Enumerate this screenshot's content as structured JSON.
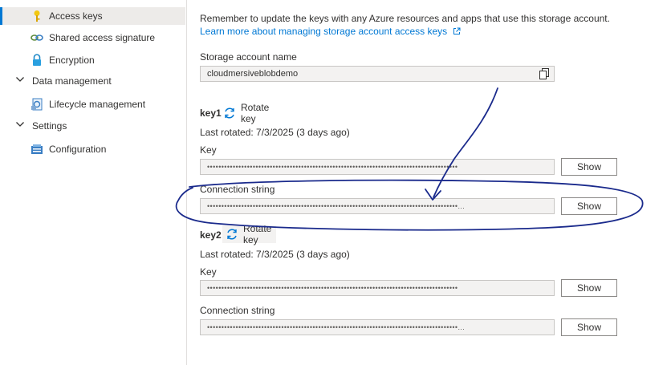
{
  "sidebar": {
    "items": [
      {
        "label": "Access keys",
        "icon": "key-icon"
      },
      {
        "label": "Shared access signature",
        "icon": "link-icon"
      },
      {
        "label": "Encryption",
        "icon": "lock-icon"
      },
      {
        "label": "Data management",
        "icon": "chevron-down-icon"
      },
      {
        "label": "Lifecycle management",
        "icon": "lifecycle-icon"
      },
      {
        "label": "Settings",
        "icon": "chevron-down-icon"
      },
      {
        "label": "Configuration",
        "icon": "configuration-icon"
      }
    ]
  },
  "main": {
    "reminder": "Remember to update the keys with any Azure resources and apps that use this storage account.",
    "learn_more": "Learn more about managing storage account access keys",
    "storage_account_label": "Storage account name",
    "storage_account_value": "cloudmersiveblobdemo",
    "key1": {
      "title": "key1",
      "rotate_label": "Rotate key",
      "last_rotated": "Last rotated: 7/3/2025 (3 days ago)",
      "key_label": "Key",
      "key_value": "••••••••••••••••••••••••••••••••••••••••••••••••••••••••••••••••••••••••••••••••••••••••",
      "conn_label": "Connection string",
      "conn_value": "••••••••••••••••••••••••••••••••••••••••••••••••••••••••••••••••••••••••••••••••••••••••...",
      "show_label": "Show"
    },
    "key2": {
      "title": "key2",
      "rotate_label": "Rotate key",
      "last_rotated": "Last rotated: 7/3/2025 (3 days ago)",
      "key_label": "Key",
      "key_value": "••••••••••••••••••••••••••••••••••••••••••••••••••••••••••••••••••••••••••••••••••••••••",
      "conn_label": "Connection string",
      "conn_value": "••••••••••••••••••••••••••••••••••••••••••••••••••••••••••••••••••••••••••••••••••••••••...",
      "show_label": "Show"
    }
  },
  "colors": {
    "accent": "#0078d4",
    "annotation_ink": "#1a2a8c",
    "key_icon": "#f2c811"
  }
}
